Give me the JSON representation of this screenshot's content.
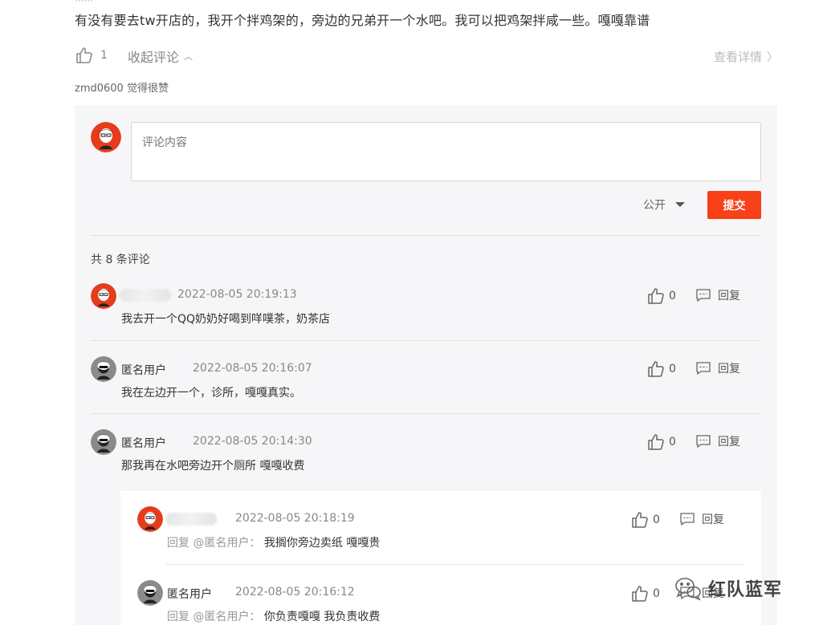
{
  "post": {
    "text": "有没有要去tw开店的，我开个拌鸡架的，旁边的兄弟开一个水吧。我可以把鸡架拌咸一些。嘎嘎靠谱",
    "like_count": "1",
    "collapse_label": "收起评论",
    "detail_label": "查看详情",
    "liked_by": "zmd0600 觉得很赞"
  },
  "composer": {
    "placeholder": "评论内容",
    "visibility": "公开",
    "submit_label": "提交"
  },
  "comments_count": "共 8 条评论",
  "comments": [
    {
      "name": "",
      "time": "2022-08-05 20:19:13",
      "text": "我去开一个QQ奶奶好喝到咩噗茶，奶茶店",
      "likes": "0",
      "reply_label": "回复"
    },
    {
      "name": "匿名用户",
      "time": "2022-08-05 20:16:07",
      "text": "我在左边开一个，诊所，嘎嘎真实。",
      "likes": "0",
      "reply_label": "回复"
    },
    {
      "name": "匿名用户",
      "time": "2022-08-05 20:14:30",
      "text": "那我再在水吧旁边开个厕所 嘎嘎收费",
      "likes": "0",
      "reply_label": "回复"
    }
  ],
  "replies": [
    {
      "name": "",
      "time": "2022-08-05 20:18:19",
      "reply_to": "回复 @匿名用户：",
      "text": "我搁你旁边卖纸 嘎嘎贵",
      "likes": "0",
      "reply_label": "回复"
    },
    {
      "name": "匿名用户",
      "time": "2022-08-05 20:16:12",
      "reply_to": "回复 @匿名用户：",
      "text": "你负责嘎嘎 我负责收费",
      "likes": "0",
      "reply_label": "回复"
    }
  ],
  "watermark": "红队蓝军",
  "colors": {
    "accent": "#f84019",
    "panel_bg": "#f6f6f8"
  }
}
